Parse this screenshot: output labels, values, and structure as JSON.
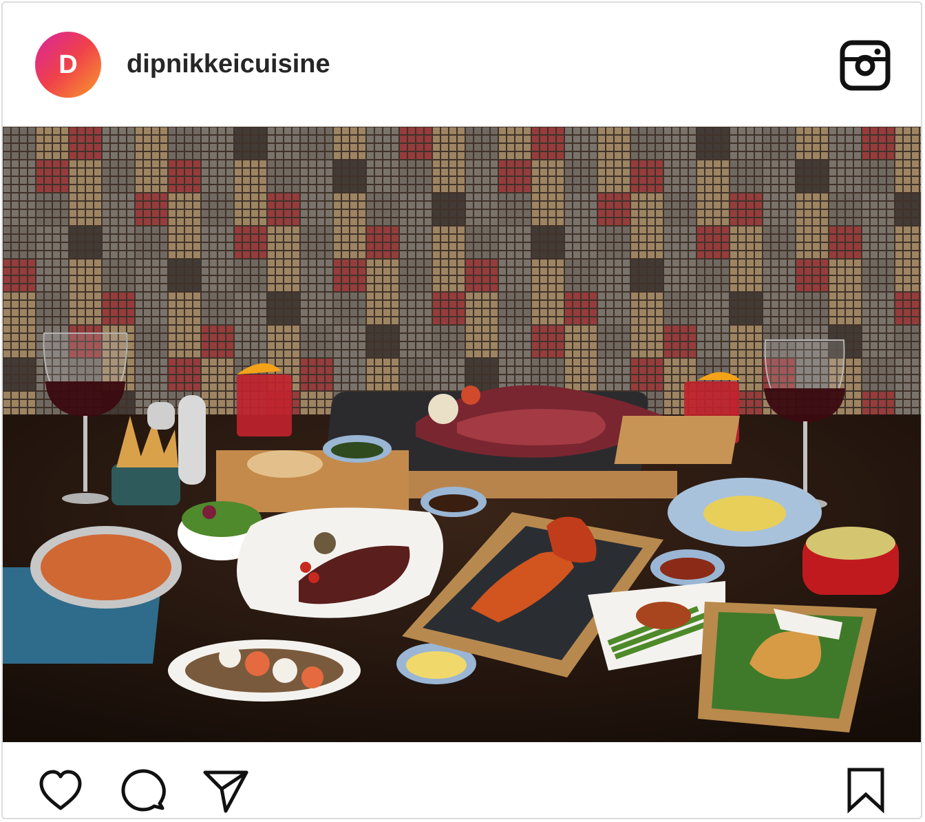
{
  "post": {
    "avatar_letter": "D",
    "username": "dipnikkeicuisine"
  },
  "colors": {
    "avatar_gradient": [
      "#d8259c",
      "#f0414a",
      "#f99b2c"
    ],
    "text": "#262626",
    "border": "#dcdcdc"
  },
  "icons": {
    "brand": "instagram-icon",
    "like": "heart-icon",
    "comment": "comment-bubble-icon",
    "share": "paper-plane-icon",
    "save": "bookmark-icon"
  }
}
